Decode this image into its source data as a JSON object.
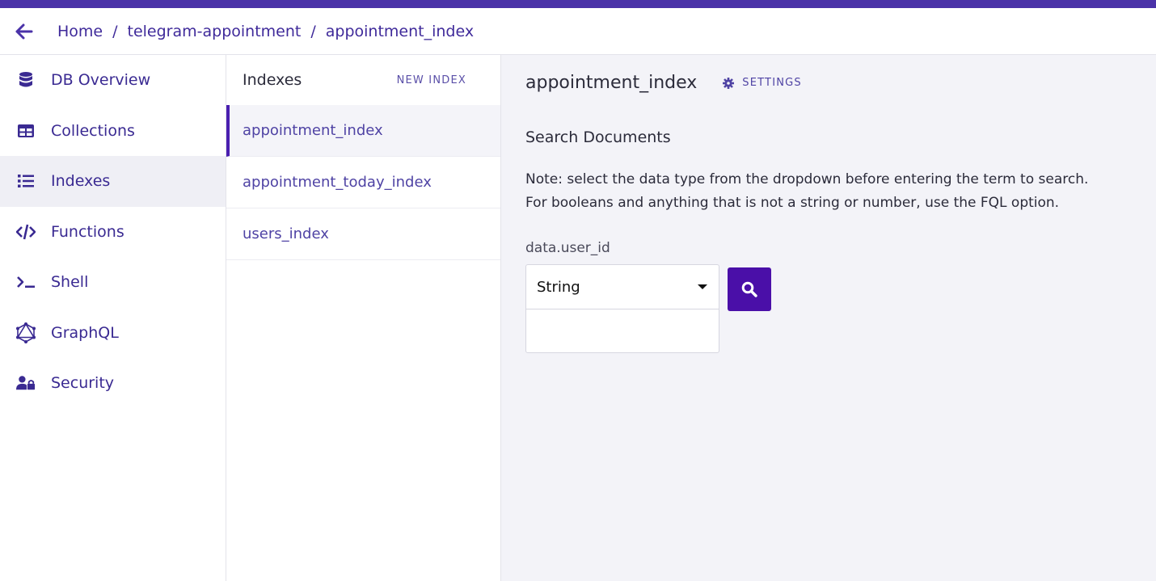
{
  "colors": {
    "brand": "#4a32a8",
    "accent": "#4a0fa8",
    "nav_text": "#3a2a92",
    "main_bg": "#f3f3f8"
  },
  "header": {
    "back_icon": "arrow-left-icon",
    "breadcrumb": [
      "Home",
      "telegram-appointment",
      "appointment_index"
    ],
    "separator": "/"
  },
  "sidebar": {
    "items": [
      {
        "label": "DB Overview",
        "icon": "database-icon",
        "active": false
      },
      {
        "label": "Collections",
        "icon": "table-icon",
        "active": false
      },
      {
        "label": "Indexes",
        "icon": "list-icon",
        "active": true
      },
      {
        "label": "Functions",
        "icon": "code-icon",
        "active": false
      },
      {
        "label": "Shell",
        "icon": "terminal-icon",
        "active": false
      },
      {
        "label": "GraphQL",
        "icon": "graphql-icon",
        "active": false
      },
      {
        "label": "Security",
        "icon": "user-lock-icon",
        "active": false
      }
    ]
  },
  "indexes_panel": {
    "title": "Indexes",
    "new_index_label": "NEW INDEX",
    "items": [
      {
        "label": "appointment_index",
        "active": true
      },
      {
        "label": "appointment_today_index",
        "active": false
      },
      {
        "label": "users_index",
        "active": false
      }
    ]
  },
  "main": {
    "title": "appointment_index",
    "settings_label": "SETTINGS",
    "section_title": "Search Documents",
    "note_line1": "Note: select the data type from the dropdown before entering the term to search.",
    "note_line2": "For booleans and anything that is not a string or number, use the FQL option.",
    "field_label": "data.user_id",
    "type_value": "String",
    "term_value": "",
    "search_icon": "search-icon"
  }
}
